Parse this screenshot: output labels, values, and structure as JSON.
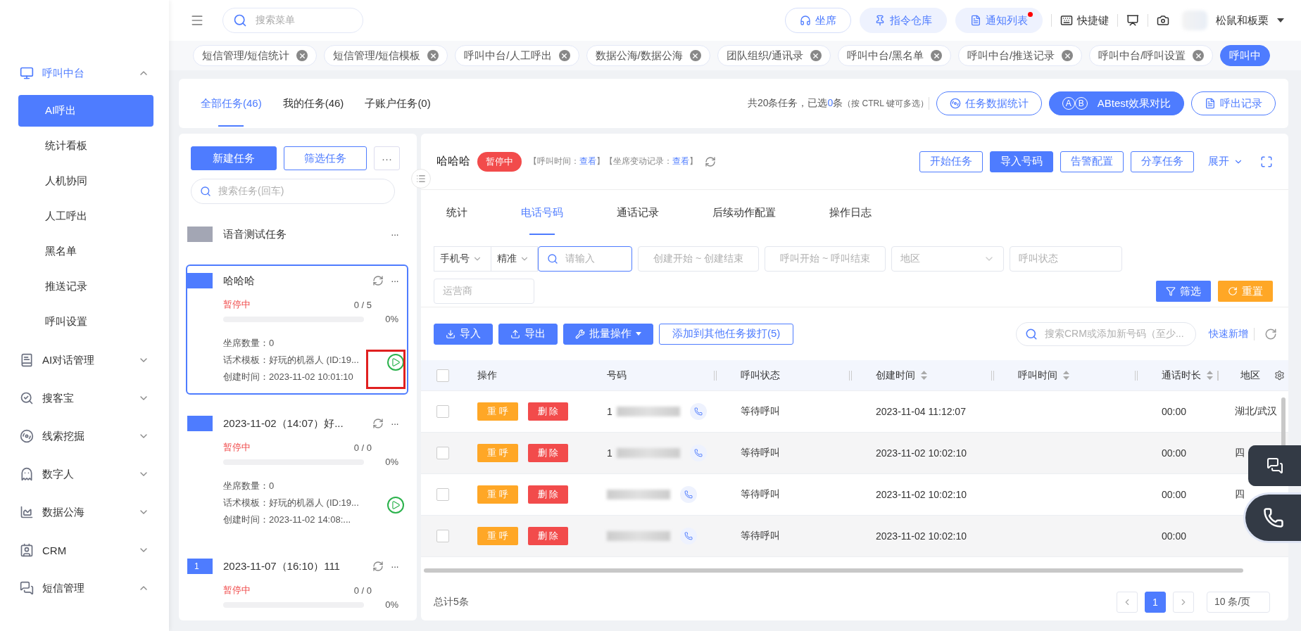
{
  "sidebar": {
    "groups": [
      {
        "label": "呼叫中台",
        "expanded": true,
        "active": true,
        "children": [
          {
            "label": "AI呼出",
            "selected": true
          },
          {
            "label": "统计看板",
            "selected": false
          },
          {
            "label": "人机协同",
            "selected": false
          },
          {
            "label": "人工呼出",
            "selected": false
          },
          {
            "label": "黑名单",
            "selected": false
          },
          {
            "label": "推送记录",
            "selected": false
          },
          {
            "label": "呼叫设置",
            "selected": false
          }
        ]
      },
      {
        "label": "AI对话管理",
        "expanded": false,
        "active": false
      },
      {
        "label": "搜客宝",
        "expanded": false,
        "active": false
      },
      {
        "label": "线索挖掘",
        "expanded": false,
        "active": false
      },
      {
        "label": "数字人",
        "expanded": false,
        "active": false
      },
      {
        "label": "数据公海",
        "expanded": false,
        "active": false
      },
      {
        "label": "CRM",
        "expanded": false,
        "active": false
      },
      {
        "label": "短信管理",
        "expanded": true,
        "active": false
      }
    ]
  },
  "header": {
    "search": {
      "placeholder": "搜索菜单"
    },
    "buttons": [
      {
        "label": "坐席",
        "kind": "outline",
        "badge": false
      },
      {
        "label": "指令仓库",
        "kind": "soft",
        "badge": false
      },
      {
        "label": "通知列表",
        "kind": "soft",
        "badge": true
      }
    ],
    "shortcut": "快捷键",
    "user": "松鼠和板栗"
  },
  "tags": [
    {
      "label": "短信管理/短信统计",
      "selected": false
    },
    {
      "label": "短信管理/短信模板",
      "selected": false
    },
    {
      "label": "呼叫中台/人工呼出",
      "selected": false
    },
    {
      "label": "数据公海/数据公海",
      "selected": false
    },
    {
      "label": "团队组织/通讯录",
      "selected": false
    },
    {
      "label": "呼叫中台/黑名单",
      "selected": false
    },
    {
      "label": "呼叫中台/推送记录",
      "selected": false
    },
    {
      "label": "呼叫中台/呼叫设置",
      "selected": false
    },
    {
      "label": "呼叫中",
      "selected": true
    }
  ],
  "task_tabs": [
    {
      "label": "全部任务(46)",
      "selected": true
    },
    {
      "label": "我的任务(46)",
      "selected": false
    },
    {
      "label": "子账户任务(0)",
      "selected": false
    }
  ],
  "summary": {
    "prefix": "共20条任务，已选",
    "count": "0",
    "suffix": "条",
    "hint": "（按 CTRL 键可多选）"
  },
  "top_buttons": [
    {
      "label": "任务数据统计",
      "kind": "outline"
    },
    {
      "label": "ABtest效果对比",
      "kind": "primary",
      "letters": [
        "A",
        "B"
      ]
    },
    {
      "label": "呼出记录",
      "kind": "outline"
    }
  ],
  "task_panel": {
    "new_button": "新建任务",
    "filter_button": "筛选任务",
    "more": "···",
    "search": {
      "placeholder": "搜索任务(回车)"
    },
    "tasks": [
      {
        "title": "语音测试任务",
        "color": "#a3a6b4",
        "kind": "simple",
        "selected": false,
        "more": "···"
      },
      {
        "title": "哈哈哈",
        "color": "#4e7cff",
        "kind": "full",
        "selected": true,
        "highlighted": true,
        "status": "暂停中",
        "progress": "0 / 5",
        "percent": "0%",
        "level": 0,
        "seats": "坐席数量：0",
        "template": "话术模板：好玩的机器人 (ID:19...",
        "created": "创建时间：2023-11-02 10:01:10",
        "more": "···"
      },
      {
        "title": "2023-11-02（14:07）好...",
        "color": "#4e7cff",
        "kind": "full",
        "selected": false,
        "status": "暂停中",
        "progress": "0 / 0",
        "percent": "0%",
        "level": 0,
        "seats": "坐席数量：0",
        "template": "话术模板：好玩的机器人 (ID:19...",
        "created": "创建时间：2023-11-02 14:08:...",
        "more": "···"
      },
      {
        "title": "2023-11-07（16:10）111",
        "color": "#4e7cff",
        "badge": "1",
        "kind": "partial",
        "selected": false,
        "status": "暂停中",
        "progress": "0 / 0",
        "percent": "0%",
        "level": 0,
        "more": "···"
      }
    ]
  },
  "detail": {
    "title": "哈哈哈",
    "status": "暂停中",
    "call_time_label": "【呼叫时间：",
    "call_time_link": "查看",
    "seat_label": "】【坐席变动记录：",
    "seat_link": "查看",
    "close": "】",
    "buttons": [
      {
        "label": "开始任务",
        "kind": "outline"
      },
      {
        "label": "导入号码",
        "kind": "primary"
      },
      {
        "label": "告警配置",
        "kind": "outline"
      },
      {
        "label": "分享任务",
        "kind": "outline"
      }
    ],
    "expand": "展开",
    "tabs": [
      {
        "label": "统计",
        "selected": false
      },
      {
        "label": "电话号码",
        "selected": true
      },
      {
        "label": "通话记录",
        "selected": false
      },
      {
        "label": "后续动作配置",
        "selected": false
      },
      {
        "label": "操作日志",
        "selected": false
      }
    ],
    "filters": {
      "phone_type": "手机号",
      "match": "精准",
      "input": {
        "placeholder": "请输入"
      },
      "created_range": [
        "创建开始",
        "~",
        "创建结束"
      ],
      "call_range": [
        "呼叫开始",
        "~",
        "呼叫结束"
      ],
      "region": {
        "placeholder": "地区"
      },
      "call_status": {
        "placeholder": "呼叫状态"
      },
      "carrier": {
        "placeholder": "运营商"
      },
      "filter_button": "筛选",
      "reset_button": "重置"
    },
    "actions": [
      {
        "label": "导入",
        "kind": "import"
      },
      {
        "label": "导出",
        "kind": "export"
      },
      {
        "label": "批量操作",
        "kind": "batch"
      },
      {
        "label": "添加到其他任务拨打(5)",
        "kind": "outline"
      }
    ],
    "crm_search": {
      "placeholder": "搜索CRM或添加新号码（至少..."
    },
    "quick_add": "快速新增",
    "table": {
      "header_checked": false,
      "columns": [
        {
          "label": "操作",
          "sortable": false
        },
        {
          "label": "号码",
          "sortable": false
        },
        {
          "label": "呼叫状态",
          "sortable": false
        },
        {
          "label": "创建时间",
          "sortable": true
        },
        {
          "label": "呼叫时间",
          "sortable": true
        },
        {
          "label": "通话时长",
          "sortable": true
        },
        {
          "label": "地区",
          "sortable": false
        }
      ],
      "rows": [
        {
          "checked": false,
          "redial": "重 呼",
          "delete": "删 除",
          "number_prefix": "1",
          "status": "等待呼叫",
          "created": "2023-11-04 11:12:07",
          "duration": "00:00",
          "region": "湖北/武汉"
        },
        {
          "checked": false,
          "redial": "重 呼",
          "delete": "删 除",
          "number_prefix": "1",
          "status": "等待呼叫",
          "created": "2023-11-02 10:02:10",
          "duration": "00:00",
          "region": "四"
        },
        {
          "checked": false,
          "redial": "重 呼",
          "delete": "删 除",
          "status": "等待呼叫",
          "created": "2023-11-02 10:02:10",
          "duration": "00:00",
          "region": "四"
        },
        {
          "checked": false,
          "redial": "重 呼",
          "delete": "删 除",
          "status": "等待呼叫",
          "created": "2023-11-02 10:02:10",
          "duration": "00:00"
        }
      ]
    },
    "footer": {
      "total": "总计5条",
      "pages": [
        {
          "label": "1",
          "selected": true
        }
      ],
      "page_size": "10 条/页"
    }
  }
}
